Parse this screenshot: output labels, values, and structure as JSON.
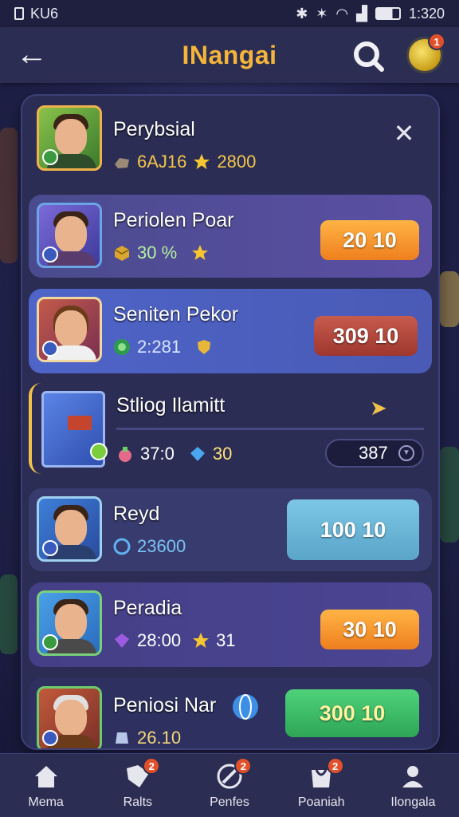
{
  "status_bar": {
    "left_text": "KU6",
    "time": "1:320"
  },
  "header": {
    "title": "INangai",
    "coin_badge": "1"
  },
  "profile": {
    "name": "Perybsial",
    "resource_value": "6AJ16",
    "star_value": "2800"
  },
  "players": [
    {
      "name": "Periolen Poar",
      "stat_value": "30 %",
      "button_label": "20 10",
      "button_color": "#f39a2e"
    },
    {
      "name": "Seniten Pekor",
      "stat_value": "2:281",
      "button_label": "309 10",
      "button_color": "#b8443a"
    },
    {
      "name": "Reyd",
      "stat_value": "23600",
      "button_label": "100 10",
      "button_color": "#6fb7d6"
    },
    {
      "name": "Peradia",
      "stat_value": "28:00",
      "star_value": "31",
      "button_label": "30 10",
      "button_color": "#f39a2e"
    },
    {
      "name": "Peniosi Nar",
      "stat_value": "26.10",
      "button_label": "300 10",
      "button_color": "#3ec265"
    }
  ],
  "item": {
    "name": "Stliog Ilamitt",
    "value_a": "37:0",
    "value_b": "30",
    "select_value": "387"
  },
  "nav": [
    {
      "label": "Mema",
      "badge": ""
    },
    {
      "label": "Ralts",
      "badge": "2"
    },
    {
      "label": "Penfes",
      "badge": "2"
    },
    {
      "label": "Poaniah",
      "badge": "2"
    },
    {
      "label": "Ilongala",
      "badge": ""
    }
  ]
}
